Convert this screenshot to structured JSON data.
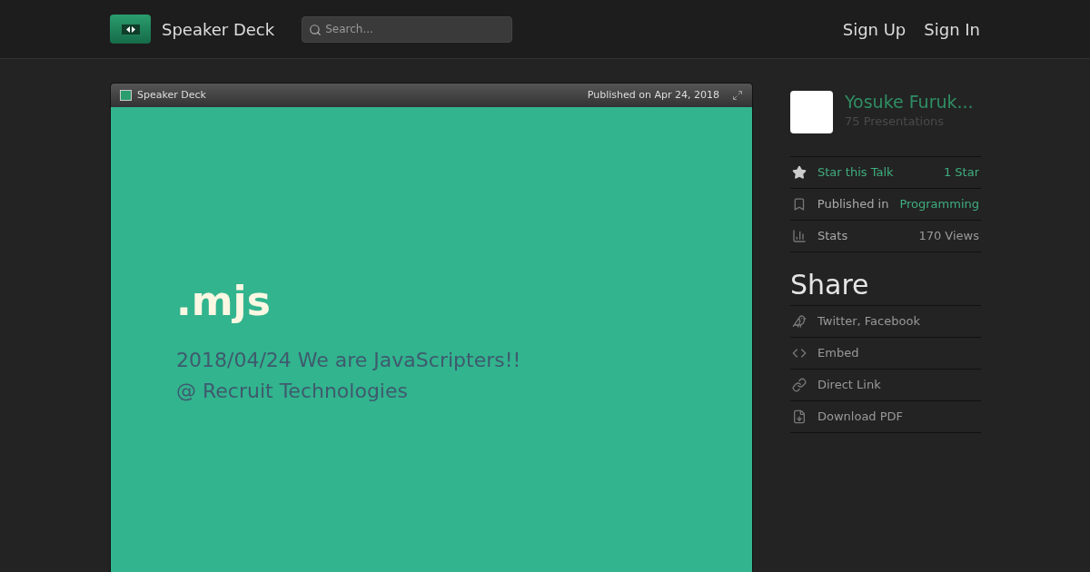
{
  "header": {
    "brand": "Speaker Deck",
    "search": {
      "placeholder": "Search..."
    },
    "nav": [
      "Sign Up",
      "Sign In"
    ]
  },
  "player": {
    "brand": "Speaker Deck",
    "published": "Published on Apr 24, 2018",
    "slide": {
      "title": ".mjs",
      "lines": [
        "2018/04/24 We are JavaScripters!!",
        "@ Recruit Technologies"
      ]
    }
  },
  "author": {
    "name": "Yosuke Furuk...",
    "count": "75 Presentations"
  },
  "details": [
    {
      "kind": "star",
      "label": "Star this Talk",
      "value": "1 Star"
    },
    {
      "kind": "category",
      "label": "Published in",
      "value": "Programming"
    },
    {
      "kind": "stats",
      "label": "Stats",
      "value": "170 Views"
    }
  ],
  "share": {
    "title": "Share",
    "items": [
      {
        "kind": "social",
        "label": "Twitter, Facebook"
      },
      {
        "kind": "embed",
        "label": "Embed"
      },
      {
        "kind": "link",
        "label": "Direct Link"
      },
      {
        "kind": "pdf",
        "label": "Download PDF"
      }
    ]
  }
}
